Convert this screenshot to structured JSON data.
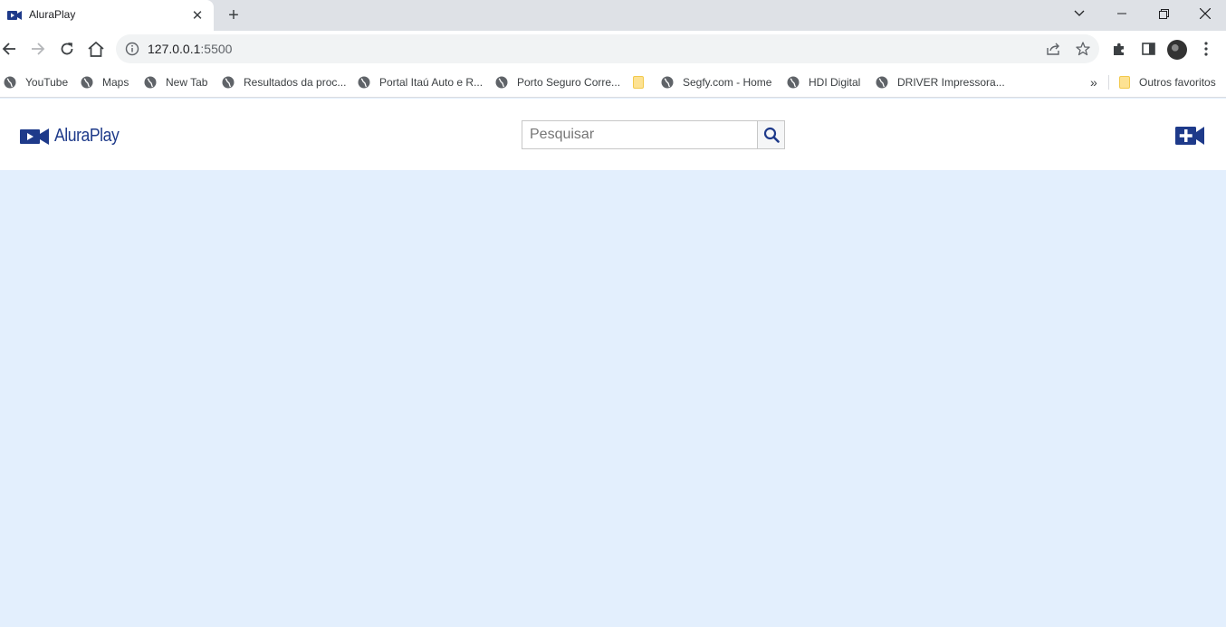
{
  "browser": {
    "tab": {
      "title": "AluraPlay"
    },
    "address": {
      "host": "127.0.0.1",
      "port": ":5500"
    },
    "bookmarks": [
      {
        "label": "YouTube",
        "icon": "globe-icon"
      },
      {
        "label": "Maps",
        "icon": "globe-icon"
      },
      {
        "label": "New Tab",
        "icon": "globe-icon"
      },
      {
        "label": "Resultados da proc...",
        "icon": "globe-icon"
      },
      {
        "label": "Portal Itaú Auto e R...",
        "icon": "globe-icon"
      },
      {
        "label": "Porto Seguro Corre...",
        "icon": "globe-icon"
      },
      {
        "label": "",
        "icon": "folder-icon"
      },
      {
        "label": "Segfy.com - Home",
        "icon": "globe-icon"
      },
      {
        "label": "HDI Digital",
        "icon": "globe-icon"
      },
      {
        "label": "DRIVER Impressora...",
        "icon": "globe-icon"
      }
    ],
    "overflow_label": "»",
    "other_bookmarks_label": "Outros favoritos"
  },
  "site": {
    "logo_text": "AluraPlay",
    "search": {
      "placeholder": "Pesquisar",
      "value": ""
    },
    "brand_color": "#1e3a8a",
    "background_color": "#e3effd"
  }
}
